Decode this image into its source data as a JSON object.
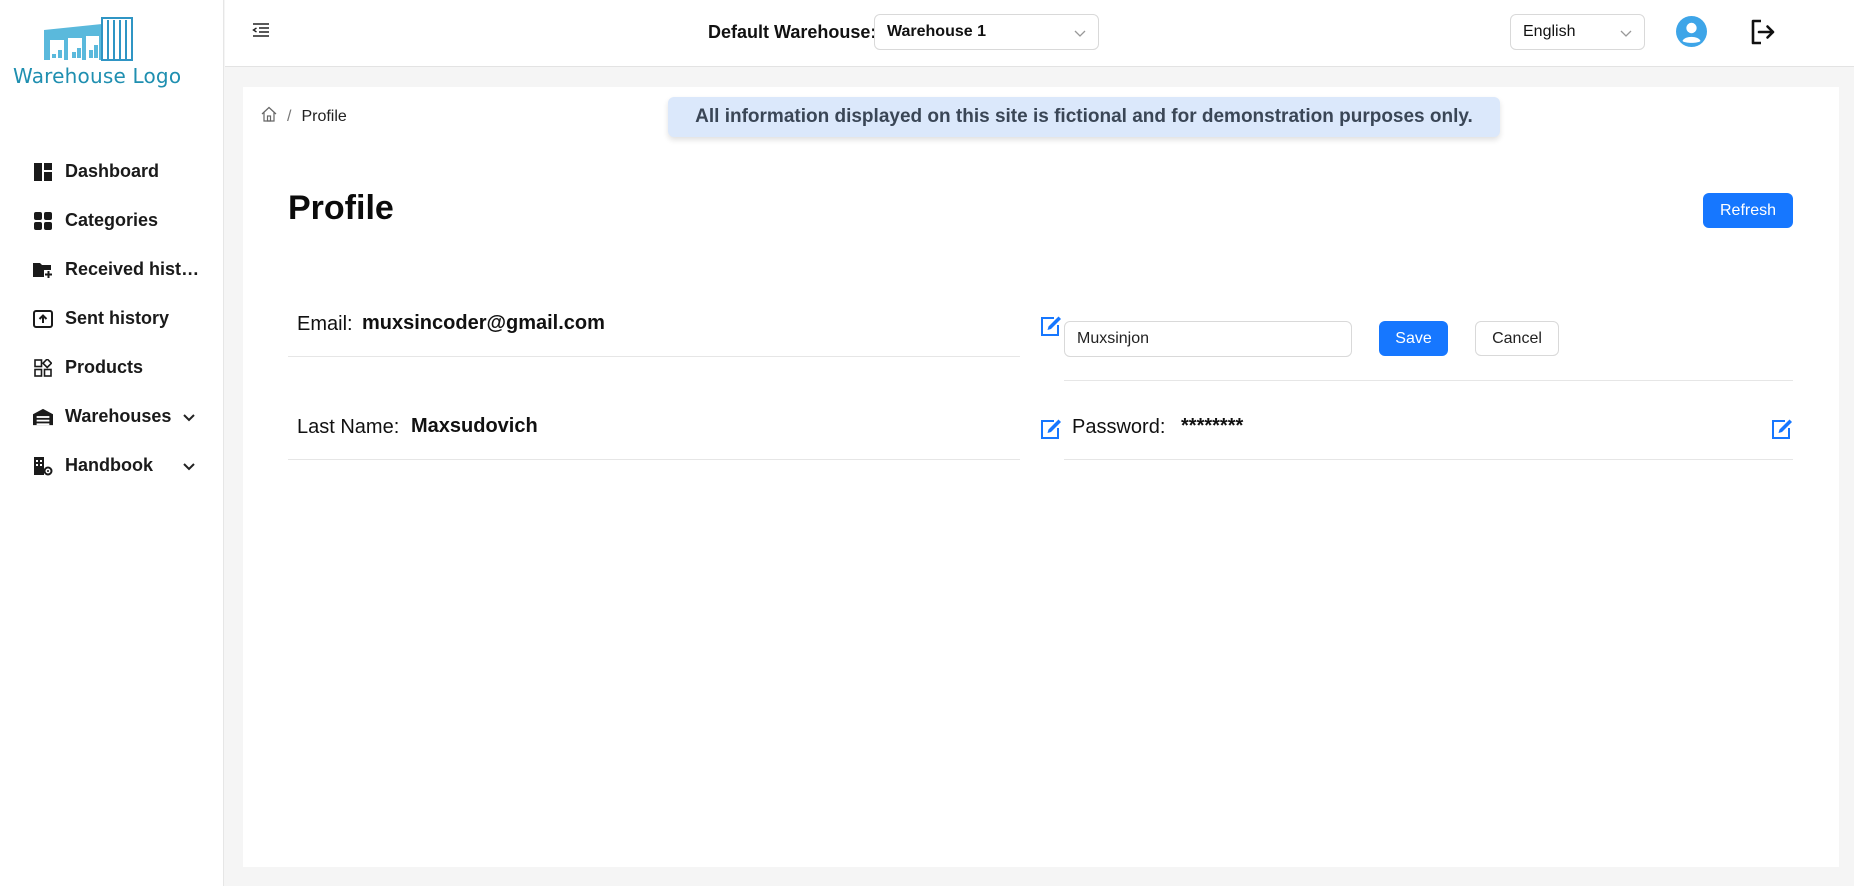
{
  "sidebar": {
    "logo_text": "Warehouse Logo",
    "items": [
      {
        "label": "Dashboard",
        "icon": "dashboard-icon"
      },
      {
        "label": "Categories",
        "icon": "categories-icon"
      },
      {
        "label": "Received histo…",
        "icon": "folder-plus-icon"
      },
      {
        "label": "Sent history",
        "icon": "upload-box-icon"
      },
      {
        "label": "Products",
        "icon": "products-grid-icon"
      },
      {
        "label": "Warehouses",
        "icon": "warehouse-icon",
        "expandable": true
      },
      {
        "label": "Handbook",
        "icon": "handbook-icon",
        "expandable": true
      }
    ]
  },
  "header": {
    "default_warehouse_label": "Default Warehouse:",
    "warehouse_value": "Warehouse 1",
    "language_value": "English"
  },
  "main": {
    "breadcrumb_current": "Profile",
    "notice": "All information displayed on this site is fictional and for demonstration purposes only.",
    "title": "Profile",
    "refresh_label": "Refresh",
    "email_label": "Email:",
    "email_value": "muxsincoder@gmail.com",
    "name_input_value": "Muxsinjon",
    "save_label": "Save",
    "cancel_label": "Cancel",
    "last_name_label": "Last Name:",
    "last_name_value": "Maxsudovich",
    "password_label": "Password:",
    "password_value": "********"
  },
  "colors": {
    "primary": "#1677ff",
    "notice_bg": "#dbe8fb",
    "logo": "#1f8fb0",
    "avatar": "#3ea5e8"
  }
}
